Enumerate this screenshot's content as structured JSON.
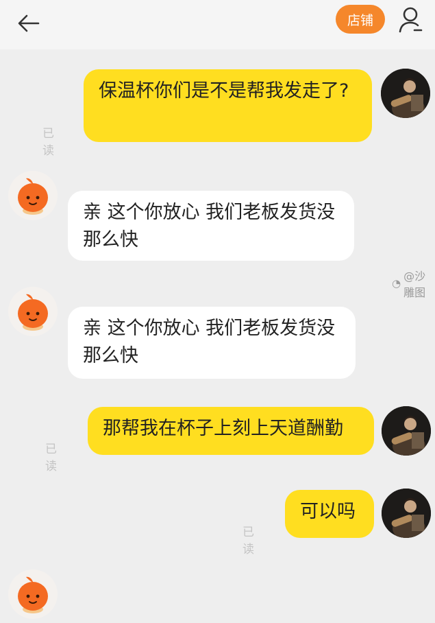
{
  "header": {
    "shop_label": "店铺"
  },
  "messages": [
    {
      "side": "out",
      "text": "保温杯你们是不是帮我发走了?",
      "status": "已读"
    },
    {
      "side": "in",
      "text": "亲 这个你放心 我们老板发货没那么快"
    },
    {
      "side": "in",
      "text": "亲 这个你放心 我们老板发货没那么快"
    },
    {
      "side": "out",
      "text": "那帮我在杯子上刻上天道酬勤",
      "status": "已读"
    },
    {
      "side": "out",
      "text": "可以吗",
      "status": "已读"
    }
  ],
  "watermark": "@沙雕图",
  "icons": {
    "back": "back-arrow-icon",
    "person": "person-icon",
    "bot": "orange-mascot-icon"
  },
  "colors": {
    "outgoing_bubble": "#ffde20",
    "incoming_bubble": "#ffffff",
    "shop_button": "#f5872b",
    "background": "#eeeeee"
  }
}
